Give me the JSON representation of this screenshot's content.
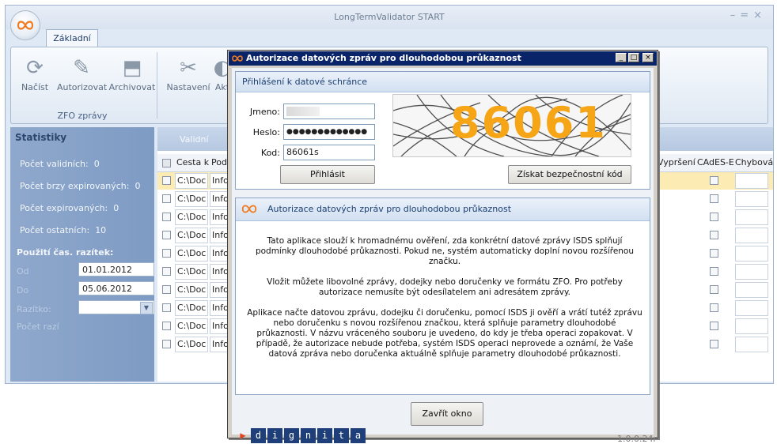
{
  "main_window": {
    "title": "LongTermValidator START",
    "tab": "Základní",
    "ribbon": {
      "buttons": [
        {
          "label": "Načíst",
          "icon": "refresh-icon"
        },
        {
          "label": "Autorizovat",
          "icon": "pencil-icon"
        },
        {
          "label": "Archivovat",
          "icon": "archive-icon"
        },
        {
          "label": "Nastavení",
          "icon": "tools-icon"
        },
        {
          "label": "Akt",
          "icon": "update-icon"
        }
      ],
      "group_label": "ZFO zprávy"
    }
  },
  "stats": {
    "header": "Statistiky",
    "items": [
      {
        "label": "Počet validních:",
        "value": "0"
      },
      {
        "label": "Počet brzy expirovaných:",
        "value": "0"
      },
      {
        "label": "Počet expirovaných:",
        "value": "0"
      },
      {
        "label": "Počet ostatních:",
        "value": "10"
      }
    ],
    "razitek_header": "Použití čas. razítek:",
    "od_label": "Od",
    "od_value": "01.01.2012",
    "do_label": "Do",
    "do_value": "05.06.2012",
    "extra_label_1": "Razítko:",
    "extra_label_2": "Počet razí"
  },
  "grid": {
    "section_label": "Validní",
    "columns": [
      "Cesta k",
      "Pod",
      "Vypršení",
      "CAdES-E",
      "Chybová"
    ],
    "rows": [
      {
        "path": "C:\\Doc",
        "info": "Info"
      },
      {
        "path": "C:\\Doc",
        "info": "Info"
      },
      {
        "path": "C:\\Doc",
        "info": "Info"
      },
      {
        "path": "C:\\Doc",
        "info": "Info"
      },
      {
        "path": "C:\\Doc",
        "info": "Info"
      },
      {
        "path": "C:\\Doc",
        "info": "Info"
      },
      {
        "path": "C:\\Doc",
        "info": "Info"
      },
      {
        "path": "C:\\Doc",
        "info": "Info"
      },
      {
        "path": "C:\\Doc",
        "info": "Info"
      },
      {
        "path": "C:\\Doc",
        "info": "Info"
      }
    ]
  },
  "dialog": {
    "title": "Autorizace datových zpráv pro dlouhodobou průkaznost",
    "login_section": "Přihlášení k datové schránce",
    "jmeno_label": "Jmeno:",
    "jmeno_value": "",
    "heslo_label": "Heslo:",
    "heslo_value": "●●●●●●●●●●●●●",
    "kod_label": "Kod:",
    "kod_value": "86061s",
    "login_button": "Přihlásit",
    "captcha_text": "86061",
    "get_code_button": "Získat bezpečnostní kód",
    "info_section": "Autorizace datových zpráv pro dlouhodobou průkaznost",
    "info_paragraphs": [
      "Tato aplikace slouží k hromadnému ověření, zda konkrétní datové zprávy ISDS splňují podmínky dlouhodobé průkaznosti. Pokud ne, systém automaticky doplní novou rozšířenou značku.",
      "Vložit můžete libovolné zprávy, dodejky nebo doručenky ve formátu ZFO. Pro potřeby autorizace nemusíte být odesílatelem ani adresátem zprávy.",
      "Aplikace načte datovou zprávu, dodejku či doručenku, pomocí ISDS ji ověří a vrátí tutéž zprávu nebo doručenku s novou rozšířenou značkou, která splňuje parametry dlouhodobé průkaznosti. V názvu vráceného souboru je uvedeno, do kdy je třeba operaci zopakovat. V případě, že autorizace nebude potřeba, systém ISDS operaci neprovede a oznámí, že Vaše datová zpráva nebo doručenka aktuálně splňuje parametry dlouhodobé průkaznosti."
    ],
    "close_button": "Zavřít okno",
    "brand_letters": [
      "d",
      "i",
      "g",
      "n",
      "i",
      "t",
      "a"
    ],
    "version": "1.0.0.24r"
  }
}
